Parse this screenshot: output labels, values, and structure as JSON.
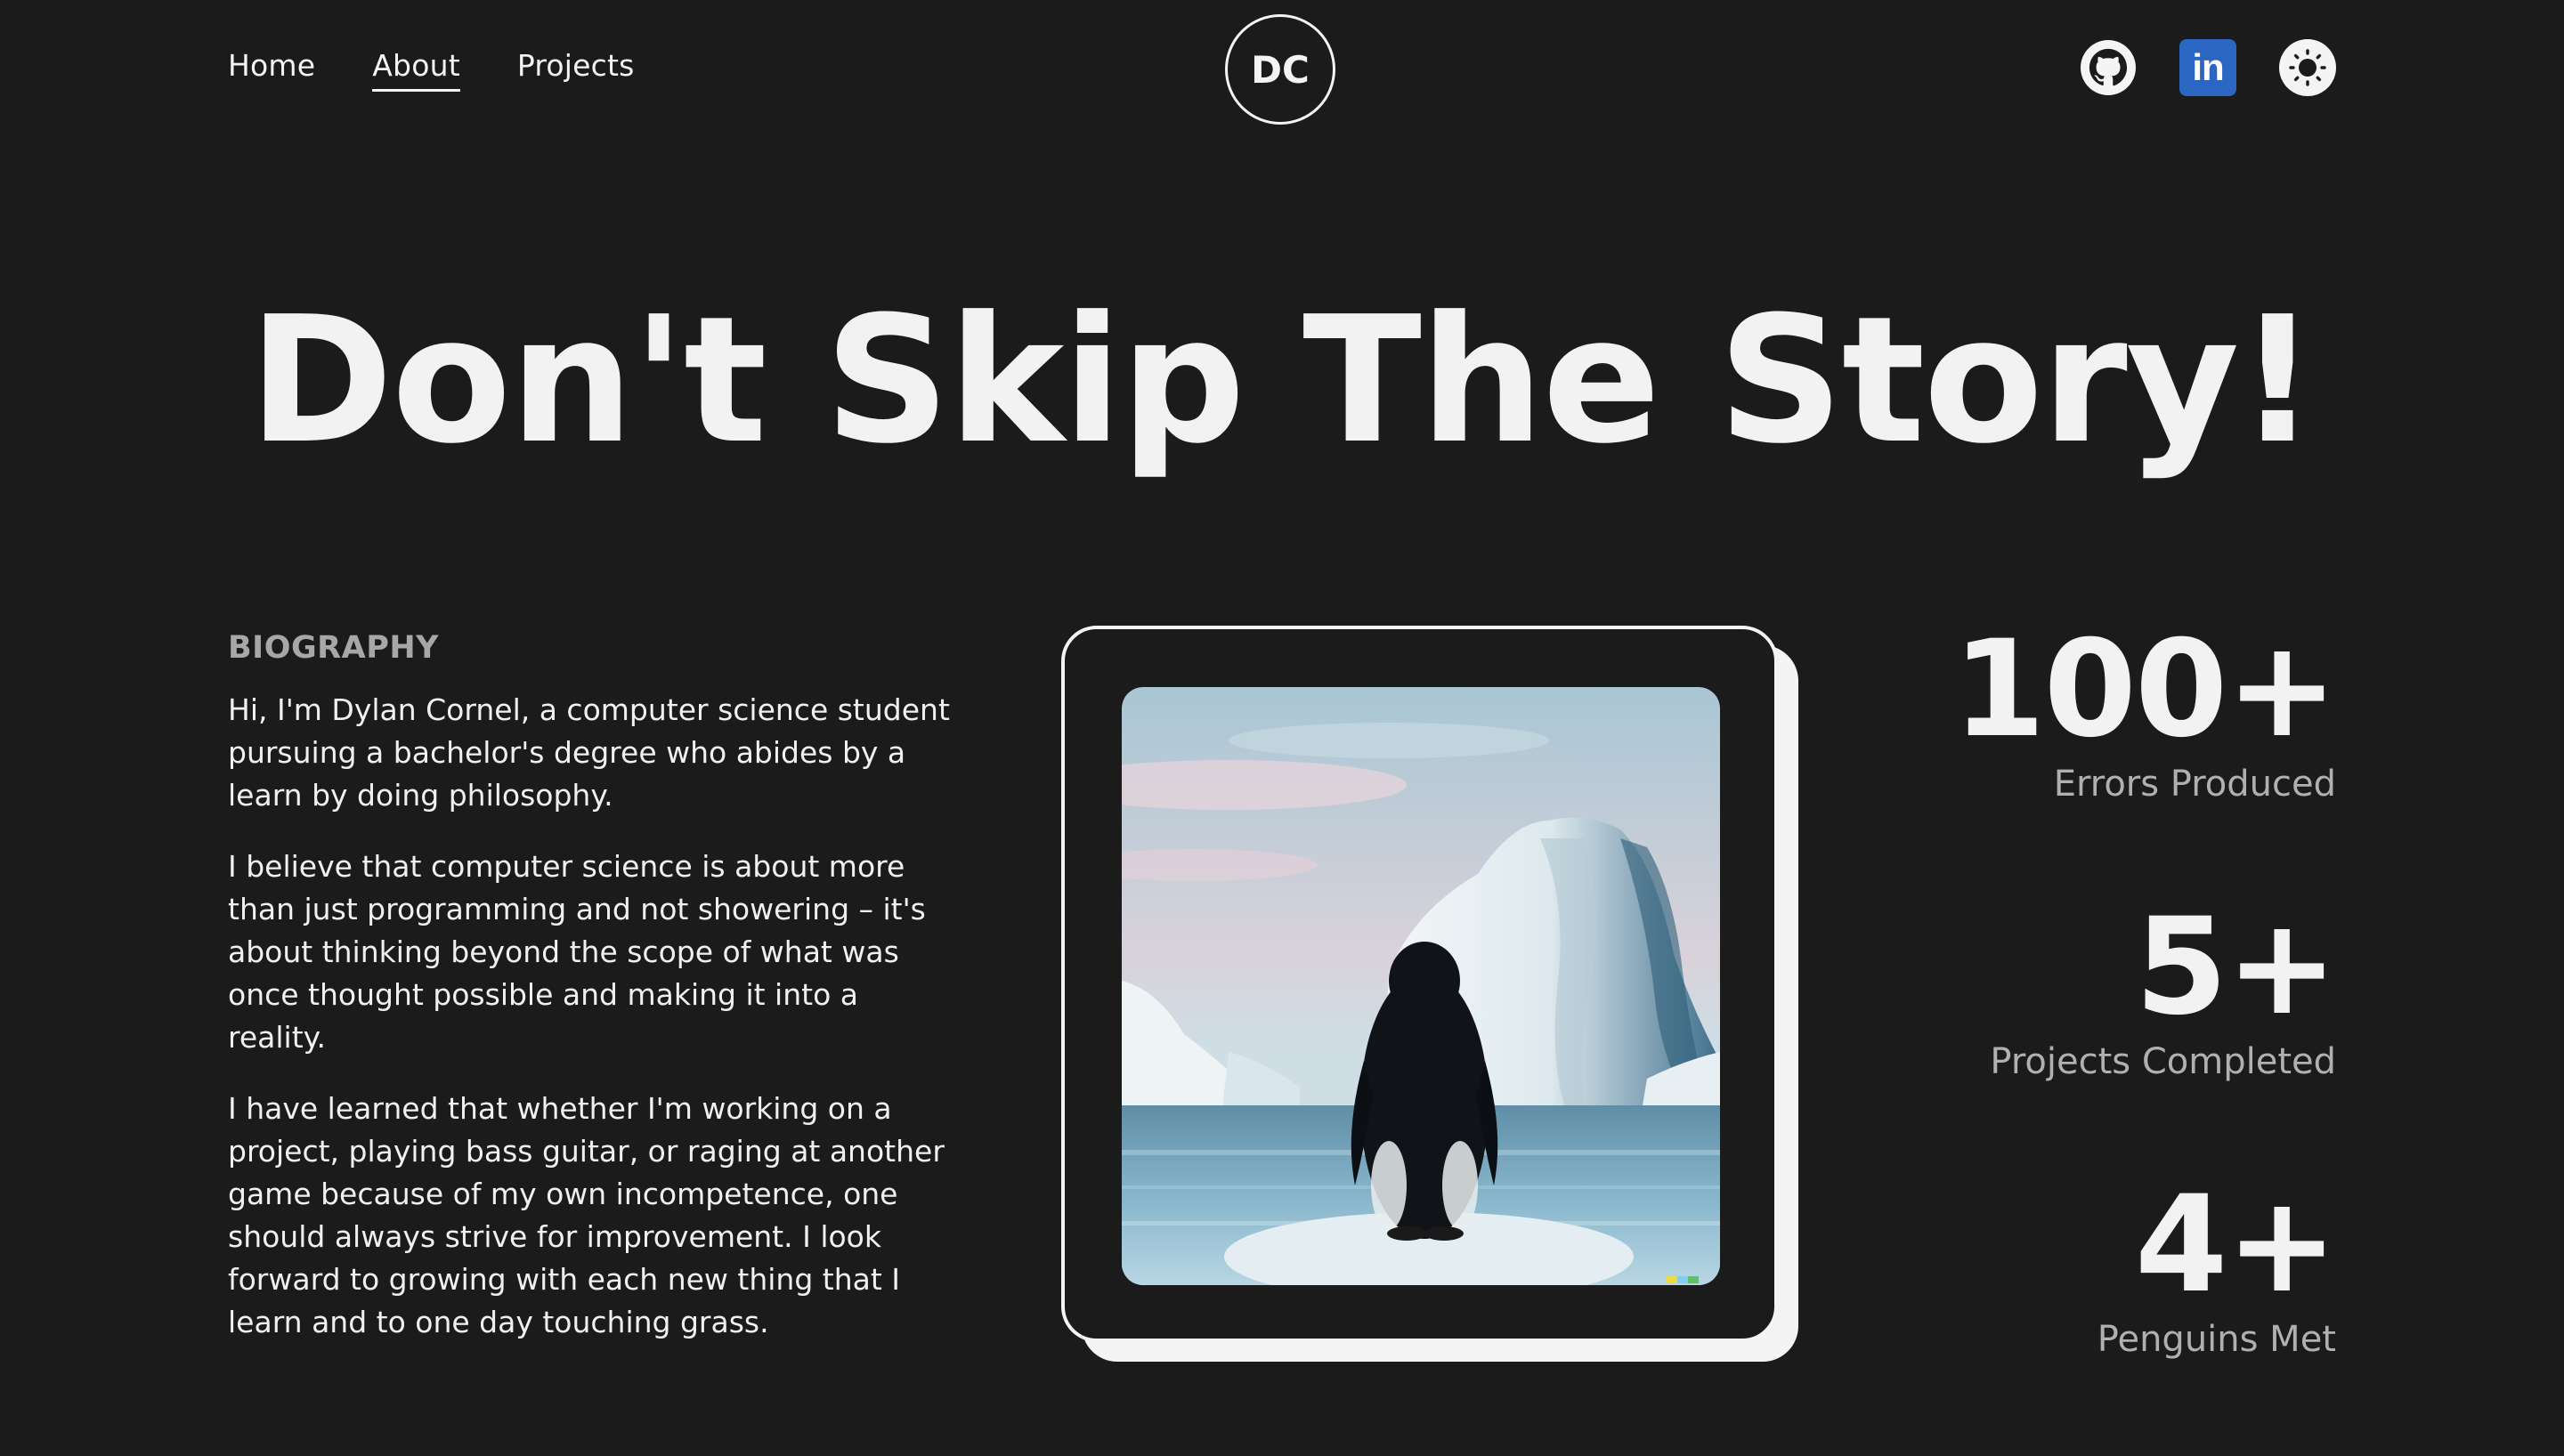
{
  "nav": {
    "links": [
      {
        "label": "Home",
        "active": false
      },
      {
        "label": "About",
        "active": true
      },
      {
        "label": "Projects",
        "active": false
      }
    ],
    "logo": "DC",
    "social": [
      {
        "icon": "github-icon"
      },
      {
        "icon": "linkedin-icon",
        "text": "in"
      },
      {
        "icon": "theme-toggle-icon"
      }
    ]
  },
  "hero": {
    "title": "Don't Skip The Story!"
  },
  "bio": {
    "heading": "BIOGRAPHY",
    "paragraphs": [
      "Hi, I'm Dylan Cornel, a computer science student pursuing a bachelor's degree who abides by a learn by doing philosophy.",
      "I believe that computer science is about more than just programming and not showering – it's about thinking beyond the scope of what was once thought possible and making it into a reality.",
      "I have learned that whether I'm working on a project, playing bass guitar, or raging at another game because of my own incompetence, one should always strive for improvement. I look forward to growing with each new thing that I learn and to one day touching grass."
    ]
  },
  "stats": [
    {
      "value": "100+",
      "label": "Errors Produced"
    },
    {
      "value": "5+",
      "label": "Projects Completed"
    },
    {
      "value": "4+",
      "label": "Penguins Met"
    }
  ],
  "colors": {
    "background": "#1b1b1b",
    "text": "#f2f2f2",
    "muted": "#b0b0b0",
    "linkedin": "#2b67c2"
  }
}
